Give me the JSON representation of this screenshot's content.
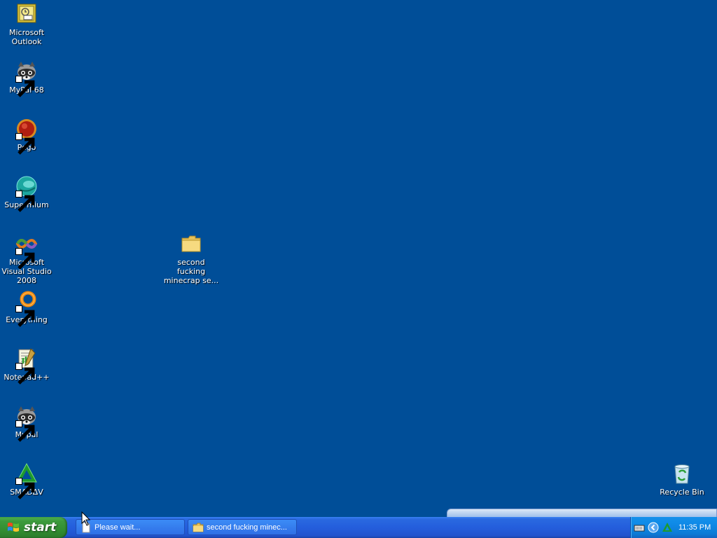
{
  "desktop": {
    "background_color": "#004E98",
    "icons": [
      {
        "label": "Microsoft Outlook",
        "icon": "outlook-icon",
        "shortcut": false
      },
      {
        "label": "MyPal 68",
        "icon": "raccoon-icon",
        "shortcut": true
      },
      {
        "label": "Pego",
        "icon": "red-orb-icon",
        "shortcut": true
      },
      {
        "label": "Supermium",
        "icon": "globe-icon",
        "shortcut": true
      },
      {
        "label": "Microsoft Visual Studio 2008",
        "icon": "visual-studio-icon",
        "shortcut": true
      },
      {
        "label": "Everything",
        "icon": "magnifier-ring-icon",
        "shortcut": true
      },
      {
        "label": "Notepad++",
        "icon": "notepad-plus-icon",
        "shortcut": true
      },
      {
        "label": "Mypal",
        "icon": "raccoon-icon",
        "shortcut": true
      },
      {
        "label": "SMADΔV",
        "icon": "green-triangle-icon",
        "shortcut": true
      }
    ],
    "folder": {
      "label": "second fucking minecrap se...",
      "icon": "folder-icon"
    },
    "recycle_bin": {
      "label": "Recycle Bin",
      "icon": "recycle-bin-icon"
    }
  },
  "taskbar": {
    "start_label": "start",
    "buttons": [
      {
        "label": "Please wait...",
        "icon": "blank-window-icon"
      },
      {
        "label": "second fucking minec...",
        "icon": "folder-icon"
      }
    ],
    "tray": {
      "icons": [
        "keyboard-icon",
        "back-arrow-icon",
        "smadav-icon"
      ],
      "time": "11:35 PM"
    }
  },
  "colors": {
    "desktop": "#004E98",
    "taskbar": "#245EDC",
    "start": "#3C9A3C",
    "tray": "#0F8BE8"
  }
}
